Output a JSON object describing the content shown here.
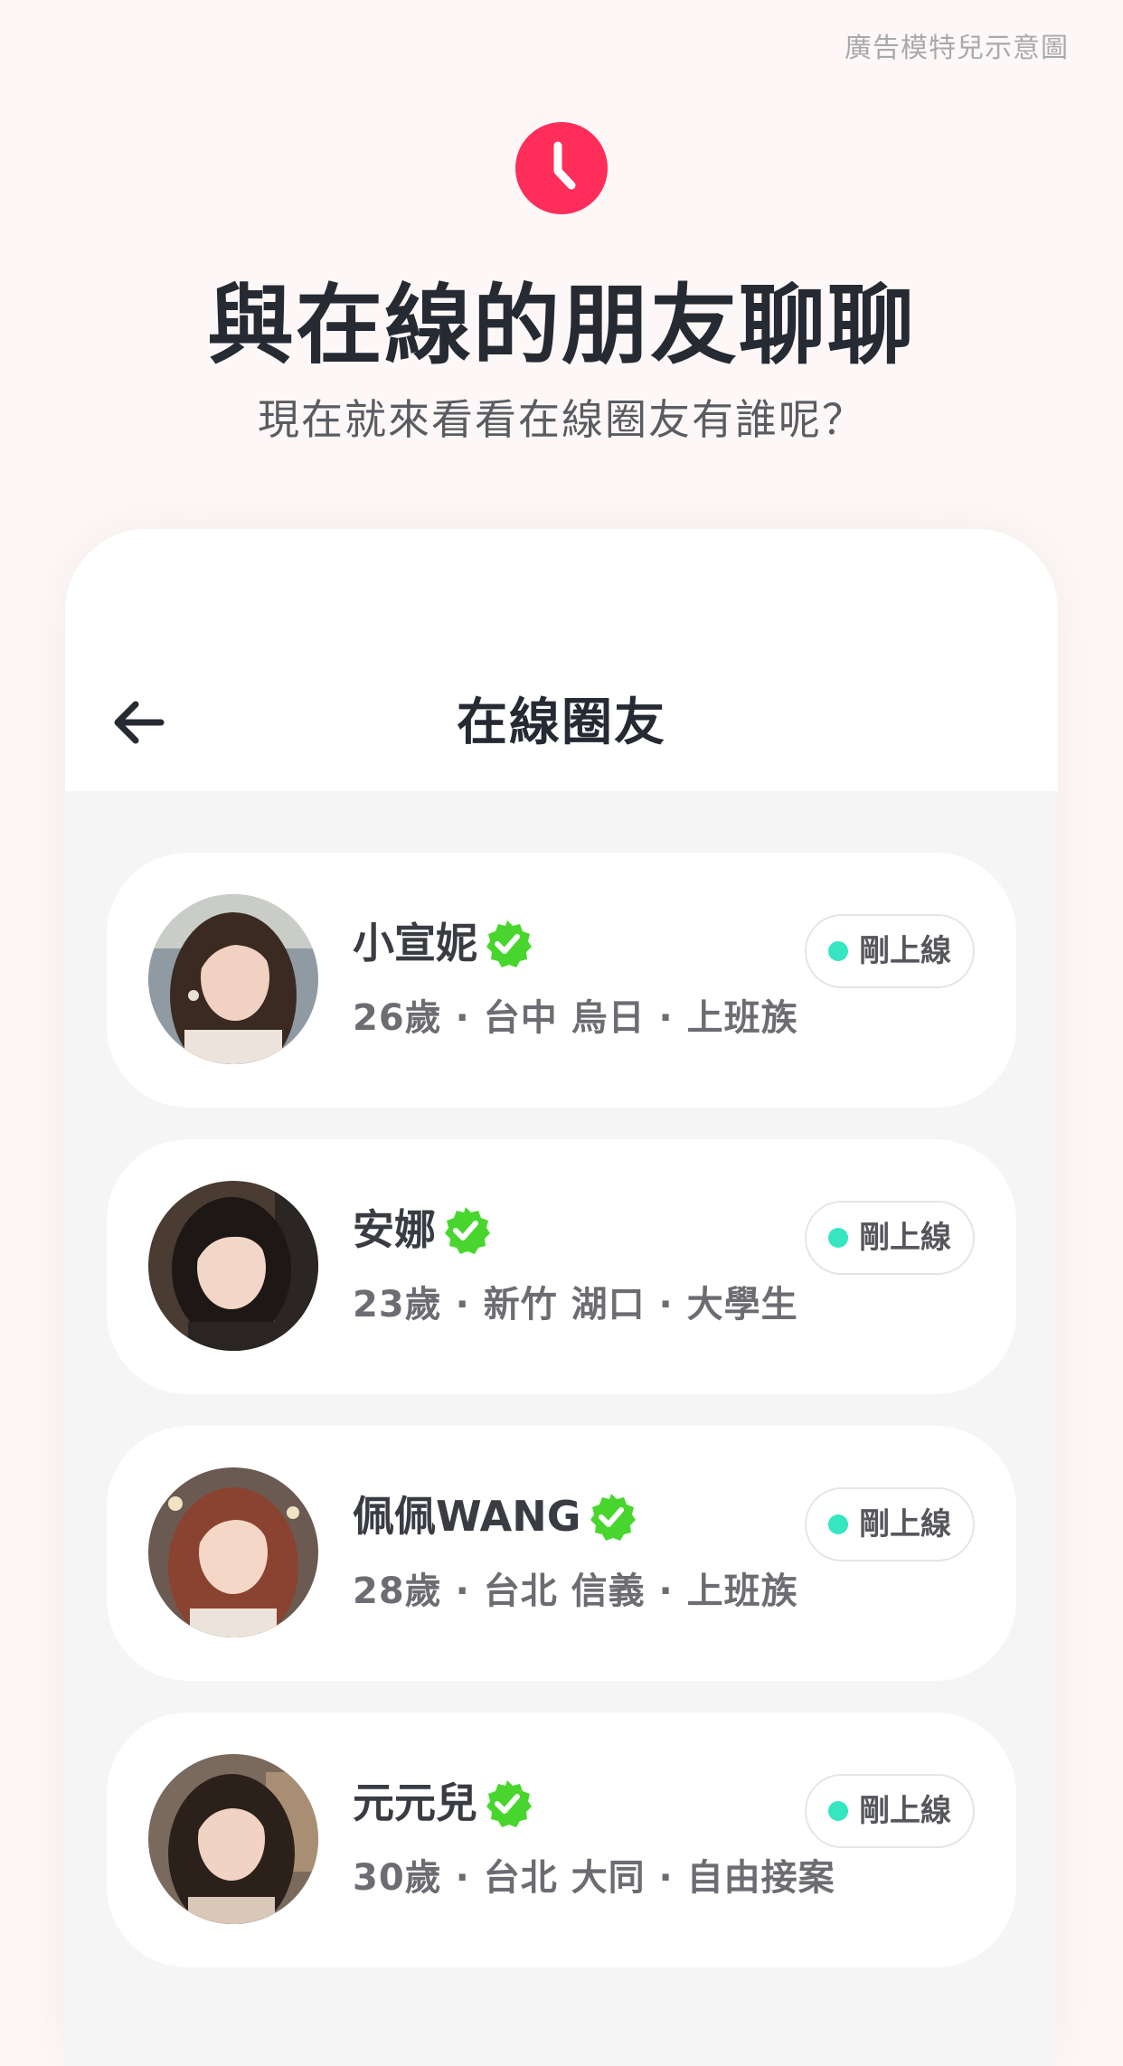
{
  "disclaimer": "廣告模特兒示意圖",
  "header": {
    "icon": "clock-icon",
    "accent_color": "#ff2d5a",
    "title": "與在線的朋友聊聊",
    "subtitle": "現在就來看看在線圈友有誰呢？"
  },
  "screen": {
    "title": "在線圈友",
    "back_icon": "arrow-left-icon"
  },
  "users": [
    {
      "name": "小宣妮",
      "verified": true,
      "meta": "26歲 · 台中 烏日 · 上班族",
      "status": "剛上線"
    },
    {
      "name": "安娜",
      "verified": true,
      "meta": "23歲 · 新竹 湖口 · 大學生",
      "status": "剛上線"
    },
    {
      "name": "佩佩WANG",
      "verified": true,
      "meta": "28歲 · 台北 信義 · 上班族",
      "status": "剛上線"
    },
    {
      "name": "元元兒",
      "verified": true,
      "meta": "30歲 · 台北 大同 · 自由接案",
      "status": "剛上線"
    }
  ],
  "colors": {
    "verified_badge": "#48d62e",
    "online_dot": "#35e6c0"
  }
}
